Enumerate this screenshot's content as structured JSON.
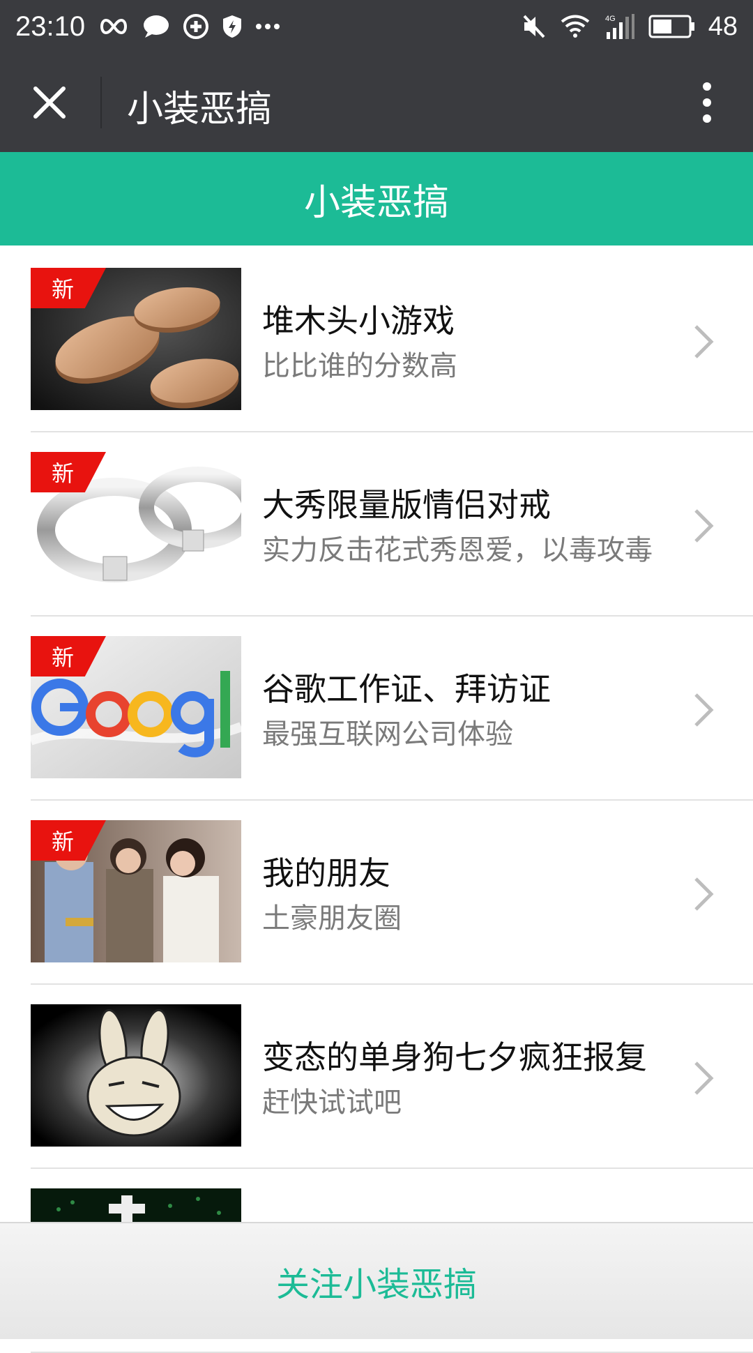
{
  "statusbar": {
    "time": "23:10",
    "battery": "48",
    "icons_left": [
      "infinity-icon",
      "chat-bubble-icon",
      "sync-icon",
      "shield-icon",
      "more-dots-icon"
    ],
    "icons_right": [
      "mute-icon",
      "wifi-icon",
      "signal-4g-icon",
      "battery-icon"
    ]
  },
  "titlebar": {
    "title": "小装恶搞"
  },
  "header": {
    "title": "小装恶搞"
  },
  "items": [
    {
      "title": "堆木头小游戏",
      "subtitle": "比比谁的分数高",
      "badge": "新",
      "thumb": "wood-blocks-image"
    },
    {
      "title": "大秀限量版情侣对戒",
      "subtitle": "实力反击花式秀恩爱，以毒攻毒",
      "badge": "新",
      "thumb": "rings-image"
    },
    {
      "title": "谷歌工作证、拜访证",
      "subtitle": "最强互联网公司体验",
      "badge": "新",
      "thumb": "google-logo-image"
    },
    {
      "title": "我的朋友",
      "subtitle": "土豪朋友圈",
      "badge": "新",
      "thumb": "friends-photo-image"
    },
    {
      "title": "变态的单身狗七夕疯狂报复",
      "subtitle": "赶快试试吧",
      "badge": "",
      "thumb": "rabbit-face-image"
    }
  ],
  "footer": {
    "label": "关注小装恶搞"
  },
  "colors": {
    "accent": "#1cbb96",
    "topbar": "#3a3b3f",
    "badge": "#e8130f"
  }
}
